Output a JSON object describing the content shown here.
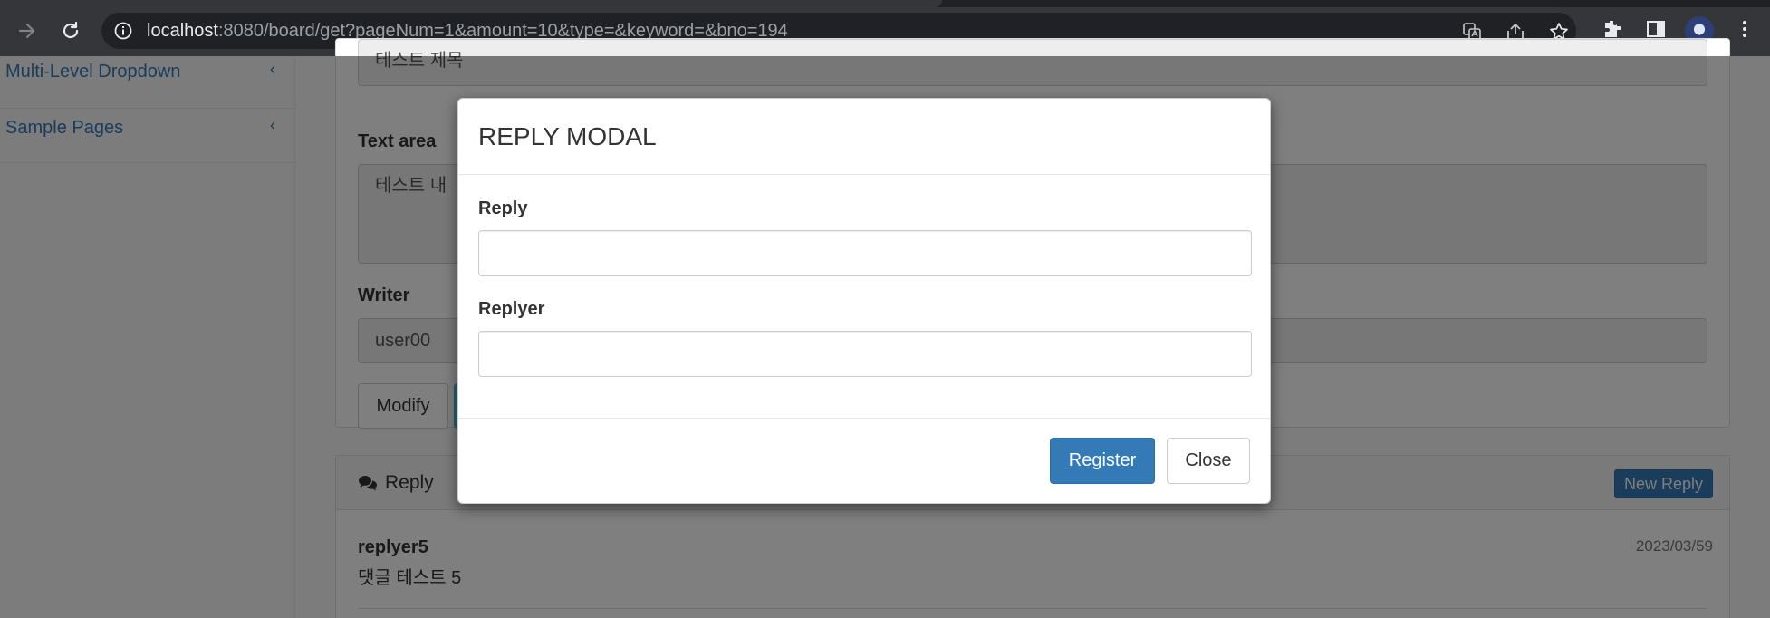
{
  "browser": {
    "url_host": "localhost",
    "url_rest": ":8080/board/get?pageNum=1&amount=10&type=&keyword=&bno=194",
    "colors": {
      "chrome": "#35363a",
      "omnibox": "#202124"
    }
  },
  "sidebar": {
    "items": [
      {
        "label": "Multi-Level Dropdown",
        "chevron": "‹"
      },
      {
        "label": "Sample Pages",
        "chevron": "‹"
      }
    ]
  },
  "board": {
    "title_value": "테스트 제목",
    "textarea_label": "Text area",
    "textarea_value": "테스트 내",
    "writer_label": "Writer",
    "writer_value": "user00",
    "modify_label": "Modify"
  },
  "reply_panel": {
    "title": "Reply",
    "new_reply_label": "New Reply",
    "items": [
      {
        "replyer": "replyer5",
        "text": "댓글 테스트 5",
        "date": "2023/03/59"
      }
    ]
  },
  "modal": {
    "title": "REPLY MODAL",
    "reply_label": "Reply",
    "reply_value": "",
    "replyer_label": "Replyer",
    "replyer_value": "",
    "register_label": "Register",
    "close_label": "Close",
    "colors": {
      "primary": "#337ab7",
      "backdrop": "rgba(0,0,0,0.5)"
    }
  }
}
